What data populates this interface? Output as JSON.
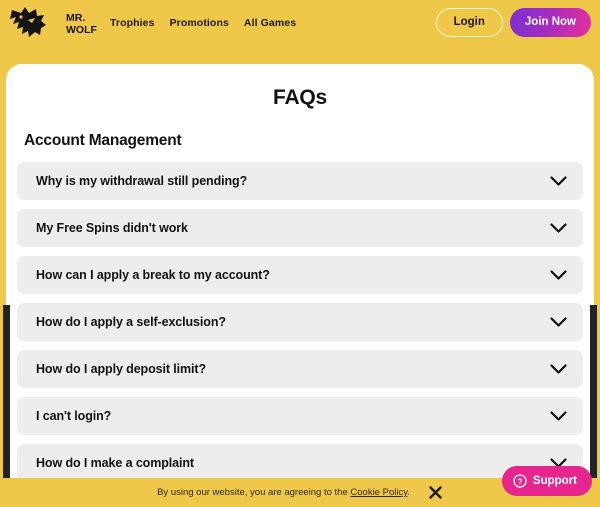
{
  "header": {
    "logo": {
      "line1": "MR.",
      "line2": "WOLF",
      "icon": "wolf-head-icon"
    },
    "nav": [
      {
        "label": "Trophies"
      },
      {
        "label": "Promotions"
      },
      {
        "label": "All Games"
      }
    ],
    "login_label": "Login",
    "join_label": "Join Now"
  },
  "page": {
    "title": "FAQs",
    "section_title": "Account Management"
  },
  "faqs": [
    {
      "question": "Why is my withdrawal still pending?",
      "icon": "chevron-down-icon"
    },
    {
      "question": "My Free Spins didn't work",
      "icon": "chevron-down-icon"
    },
    {
      "question": "How can I apply a break to my account?",
      "icon": "chevron-down-icon"
    },
    {
      "question": "How do I apply a self-exclusion?",
      "icon": "chevron-down-icon"
    },
    {
      "question": "How do I apply deposit limit?",
      "icon": "chevron-down-icon"
    },
    {
      "question": "I can't login?",
      "icon": "chevron-down-icon"
    },
    {
      "question": "How do I make a complaint",
      "icon": "chevron-down-icon"
    }
  ],
  "cookie": {
    "text_before": "By using our website, you are agreeing to the ",
    "link": "Cookie Policy",
    "text_after": ".",
    "close_icon": "close-icon"
  },
  "support": {
    "label": "Support",
    "icon": "question-circle-icon"
  },
  "colors": {
    "brand_yellow": "#efc84a",
    "card_white": "#ffffff",
    "accordion_grey": "#ededed",
    "text_dark": "#121212",
    "join_gradient_start": "#7b2fd4",
    "join_gradient_end": "#e62e9b",
    "support_pink": "#e6268e",
    "scrollbar_dark": "#222222"
  }
}
